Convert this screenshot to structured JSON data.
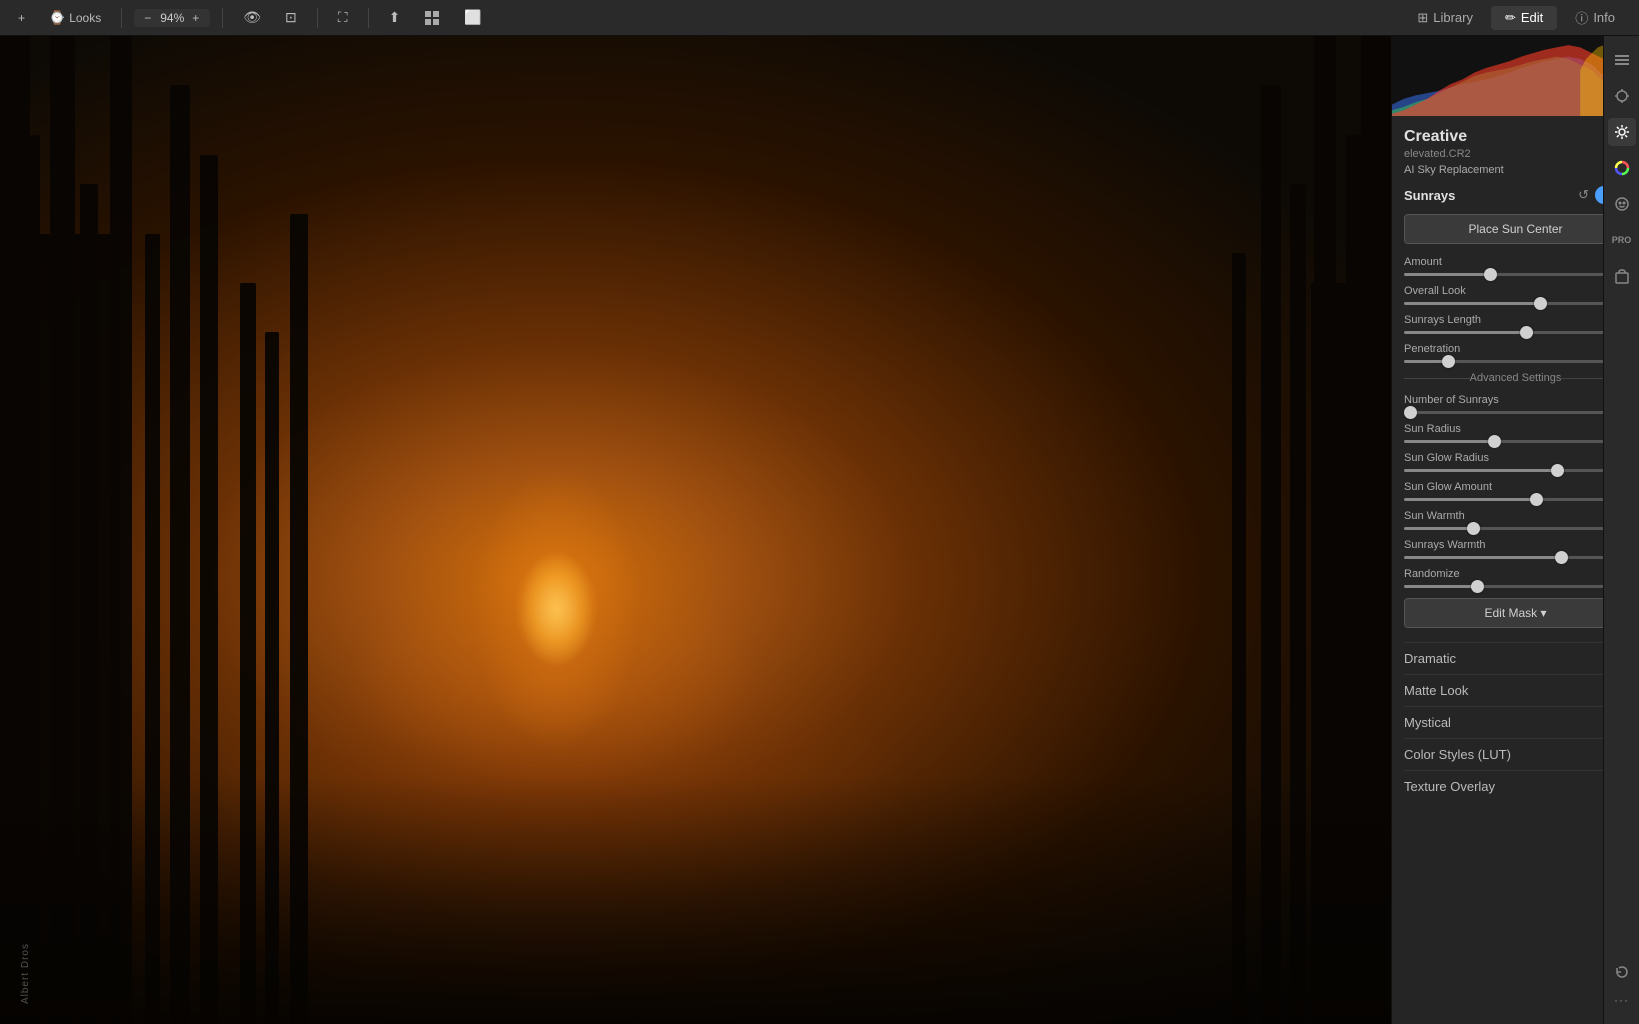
{
  "toolbar": {
    "add_label": "+",
    "looks_label": "Looks",
    "zoom_value": "94%",
    "zoom_minus": "−",
    "zoom_plus": "+",
    "tab_library": "Library",
    "tab_edit": "Edit",
    "tab_info": "Info"
  },
  "panel": {
    "section_title": "Creative",
    "file_name": "elevated.CR2",
    "ai_sky_label": "AI Sky Replacement",
    "sunrays_title": "Sunrays",
    "place_sun_btn": "Place Sun Center",
    "sliders": [
      {
        "label": "Amount",
        "value": 38,
        "min": 0,
        "max": 100,
        "pct": 38
      },
      {
        "label": "Overall Look",
        "value": 62,
        "min": 0,
        "max": 100,
        "pct": 62
      },
      {
        "label": "Sunrays Length",
        "value": 55,
        "min": 0,
        "max": 100,
        "pct": 55
      },
      {
        "label": "Penetration",
        "value": 18,
        "min": 0,
        "max": 100,
        "pct": 18
      }
    ],
    "advanced_settings_label": "Advanced Settings",
    "advanced_sliders": [
      {
        "label": "Number of Sunrays",
        "value": 0,
        "min": 0,
        "max": 100,
        "pct": 0
      },
      {
        "label": "Sun Radius",
        "value": 40,
        "min": 0,
        "max": 100,
        "pct": 40
      },
      {
        "label": "Sun Glow Radius",
        "value": 70,
        "min": 0,
        "max": 100,
        "pct": 70
      },
      {
        "label": "Sun Glow Amount",
        "value": 60,
        "min": 0,
        "max": 100,
        "pct": 60
      },
      {
        "label": "Sun Warmth",
        "value": 30,
        "min": 0,
        "max": 100,
        "pct": 30
      },
      {
        "label": "Sunrays Warmth",
        "value": 72,
        "min": 0,
        "max": 100,
        "pct": 72
      },
      {
        "label": "Randomize",
        "value": 32,
        "min": 0,
        "max": 100,
        "pct": 32
      }
    ],
    "edit_mask_btn": "Edit Mask ▾",
    "additional_sections": [
      "Dramatic",
      "Matte Look",
      "Mystical",
      "Color Styles (LUT)",
      "Texture Overlay"
    ]
  },
  "watermark": "Albert Dros"
}
